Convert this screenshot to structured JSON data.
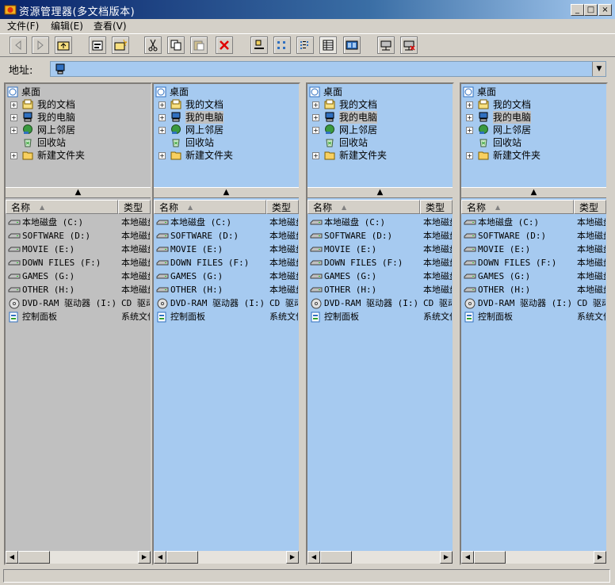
{
  "window": {
    "title": "资源管理器(多文档版本)",
    "controls": {
      "minimize": "_",
      "maximize": "□",
      "close": "×"
    }
  },
  "menu": [
    {
      "label": "文件(F)"
    },
    {
      "label": "编辑(E)"
    },
    {
      "label": "查看(V)"
    }
  ],
  "toolbar": {
    "buttons": [
      "back-icon",
      "forward-icon",
      "up-folder-icon",
      "properties-icon",
      "new-folder-icon",
      "cut-icon",
      "copy-icon",
      "paste-icon",
      "delete-icon",
      "large-icons-icon",
      "small-icons-icon",
      "list-view-icon",
      "details-view-icon",
      "thumbnails-icon",
      "map-drive-icon",
      "disconnect-drive-icon"
    ]
  },
  "address": {
    "label": "地址:",
    "value": ""
  },
  "panes": [
    {
      "background": "#c0c0c0",
      "tree": {
        "root": "桌面",
        "items": [
          "我的文档",
          "我的电脑",
          "网上邻居",
          "回收站",
          "新建文件夹"
        ],
        "selected": 1
      },
      "columns": [
        "名称",
        "类型"
      ],
      "files": [
        {
          "name": "本地磁盘 (C:)",
          "type": "本地磁盘"
        },
        {
          "name": "SOFTWARE (D:)",
          "type": "本地磁盘"
        },
        {
          "name": "MOVIE (E:)",
          "type": "本地磁盘"
        },
        {
          "name": "DOWN FILES (F:)",
          "type": "本地磁盘"
        },
        {
          "name": "GAMES (G:)",
          "type": "本地磁盘"
        },
        {
          "name": "OTHER (H:)",
          "type": "本地磁盘"
        },
        {
          "name": "DVD-RAM 驱动器 (I:)",
          "type": "CD 驱动器"
        },
        {
          "name": "控制面板",
          "type": "系统文件夹"
        }
      ]
    },
    {
      "background": "#a6caf0",
      "tree": {
        "root": "桌面",
        "items": [
          "我的文档",
          "我的电脑",
          "网上邻居",
          "回收站",
          "新建文件夹"
        ],
        "selected": 1
      },
      "columns": [
        "名称",
        "类型"
      ],
      "files": [
        {
          "name": "本地磁盘 (C:)",
          "type": "本地磁盘"
        },
        {
          "name": "SOFTWARE (D:)",
          "type": "本地磁盘"
        },
        {
          "name": "MOVIE (E:)",
          "type": "本地磁盘"
        },
        {
          "name": "DOWN FILES (F:)",
          "type": "本地磁盘"
        },
        {
          "name": "GAMES (G:)",
          "type": "本地磁盘"
        },
        {
          "name": "OTHER (H:)",
          "type": "本地磁盘"
        },
        {
          "name": "DVD-RAM 驱动器 (I:)",
          "type": "CD 驱动器"
        },
        {
          "name": "控制面板",
          "type": "系统文件夹"
        }
      ]
    },
    {
      "background": "#a6caf0",
      "tree": {
        "root": "桌面",
        "items": [
          "我的文档",
          "我的电脑",
          "网上邻居",
          "回收站",
          "新建文件夹"
        ],
        "selected": 1
      },
      "columns": [
        "名称",
        "类型"
      ],
      "files": [
        {
          "name": "本地磁盘 (C:)",
          "type": "本地磁盘"
        },
        {
          "name": "SOFTWARE (D:)",
          "type": "本地磁盘"
        },
        {
          "name": "MOVIE (E:)",
          "type": "本地磁盘"
        },
        {
          "name": "DOWN FILES (F:)",
          "type": "本地磁盘"
        },
        {
          "name": "GAMES (G:)",
          "type": "本地磁盘"
        },
        {
          "name": "OTHER (H:)",
          "type": "本地磁盘"
        },
        {
          "name": "DVD-RAM 驱动器 (I:)",
          "type": "CD 驱动器"
        },
        {
          "name": "控制面板",
          "type": "系统文件夹"
        }
      ]
    },
    {
      "background": "#a6caf0",
      "tree": {
        "root": "桌面",
        "items": [
          "我的文档",
          "我的电脑",
          "网上邻居",
          "回收站",
          "新建文件夹"
        ],
        "selected": 1
      },
      "columns": [
        "名称",
        "类型"
      ],
      "files": [
        {
          "name": "本地磁盘 (C:)",
          "type": "本地磁盘"
        },
        {
          "name": "SOFTWARE (D:)",
          "type": "本地磁盘"
        },
        {
          "name": "MOVIE (E:)",
          "type": "本地磁盘"
        },
        {
          "name": "DOWN FILES (F:)",
          "type": "本地磁盘"
        },
        {
          "name": "GAMES (G:)",
          "type": "本地磁盘"
        },
        {
          "name": "OTHER (H:)",
          "type": "本地磁盘"
        },
        {
          "name": "DVD-RAM 驱动器 (I:)",
          "type": "CD 驱动器"
        },
        {
          "name": "控制面板",
          "type": "系统文件夹"
        }
      ]
    }
  ],
  "colors": {
    "title_bar": "#0a246a",
    "pane_active": "#a6caf0",
    "pane_inactive": "#c0c0c0",
    "chrome": "#d4d0c8"
  }
}
